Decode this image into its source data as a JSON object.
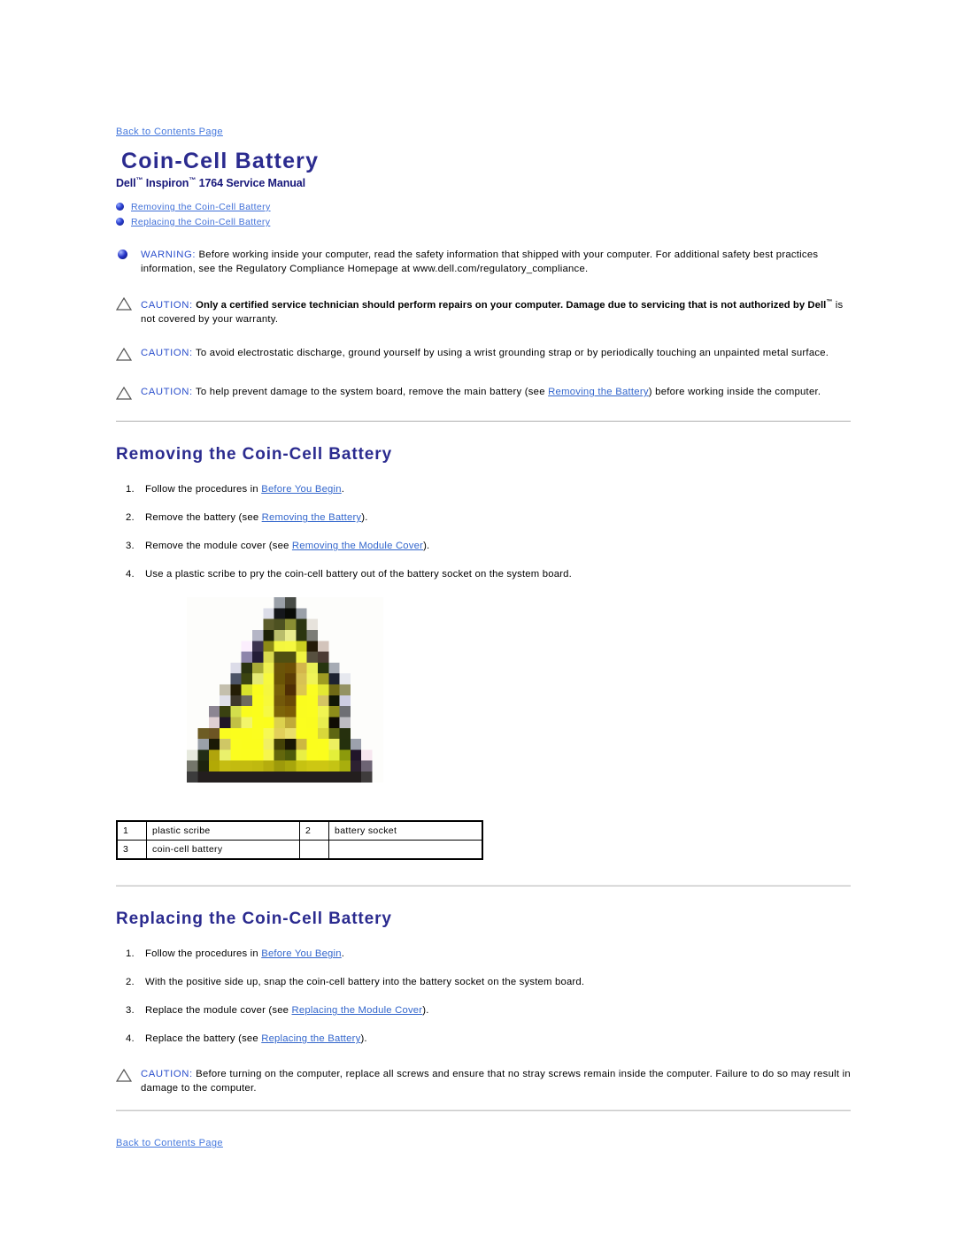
{
  "nav": {
    "back_to_contents": "Back to Contents Page"
  },
  "header": {
    "title": "Coin-Cell Battery",
    "subtitle_pre": "Dell",
    "subtitle_tm1": "™",
    "subtitle_mid": " Inspiron",
    "subtitle_tm2": "™",
    "subtitle_post": " 1764 Service Manual"
  },
  "toc": {
    "items": [
      {
        "label": "Removing the Coin-Cell Battery"
      },
      {
        "label": "Replacing the Coin-Cell Battery"
      }
    ]
  },
  "notices": [
    {
      "icon": "blue-sphere-icon",
      "keyword": "WARNING:",
      "text_a": " Before working inside your computer, read the safety information that shipped with your computer. For additional safety best practices information, see the Regulatory Compliance Homepage at www.dell.com/regulatory_compliance.",
      "bold": "",
      "text_b": "",
      "link": "",
      "text_c": ""
    },
    {
      "icon": "caution-triangle-icon",
      "keyword": "CAUTION:",
      "text_a": " ",
      "bold": "Only a certified service technician should perform repairs on your computer. Damage due to servicing that is not authorized by Dell",
      "bold_tm": "™",
      "text_b": " is not covered by your warranty.",
      "link": "",
      "text_c": ""
    },
    {
      "icon": "caution-triangle-icon",
      "keyword": "CAUTION:",
      "text_a": " To avoid electrostatic discharge, ground yourself by using a wrist grounding strap or by periodically touching an unpainted metal surface.",
      "bold": "",
      "text_b": "",
      "link": "",
      "text_c": ""
    },
    {
      "icon": "caution-triangle-icon",
      "keyword": "CAUTION:",
      "text_a": " To help prevent damage to the system board, remove the main battery (see ",
      "bold": "",
      "text_b": "",
      "link": "Removing the Battery",
      "text_c": ") before working inside the computer."
    }
  ],
  "removing": {
    "title": "Removing the Coin-Cell Battery",
    "steps": [
      {
        "num": "1.",
        "pre": "Follow the procedures in ",
        "link": "Before You Begin",
        "post": "."
      },
      {
        "num": "2.",
        "pre": "Remove the battery (see ",
        "link": "Removing the Battery",
        "post": ")."
      },
      {
        "num": "3.",
        "pre": "Remove the module cover (see ",
        "link": "Removing the Module Cover",
        "post": ")."
      },
      {
        "num": "4.",
        "pre": "Use a plastic scribe to pry the coin-cell battery out of the battery socket on the system board.",
        "link": "",
        "post": ""
      }
    ]
  },
  "figure": {
    "alt": "pixelated-yellow-warning-triangle-image"
  },
  "parts_table": {
    "rows": [
      {
        "n1": "1",
        "l1": "plastic scribe",
        "n2": "2",
        "l2": "battery socket"
      },
      {
        "n1": "3",
        "l1": "coin-cell battery",
        "n2": "",
        "l2": ""
      }
    ]
  },
  "replacing": {
    "title": "Replacing the Coin-Cell Battery",
    "steps": [
      {
        "num": "1.",
        "pre": "Follow the procedures in ",
        "link": "Before You Begin",
        "post": "."
      },
      {
        "num": "2.",
        "pre": "With the positive side up, snap the coin-cell battery into the battery socket on the system board.",
        "link": "",
        "post": ""
      },
      {
        "num": "3.",
        "pre": "Replace the module cover (see ",
        "link": "Replacing the Module Cover",
        "post": ")."
      },
      {
        "num": "4.",
        "pre": "Replace the battery (see ",
        "link": "Replacing the Battery",
        "post": ")."
      }
    ]
  },
  "final_notice": {
    "icon": "caution-triangle-icon",
    "keyword": "CAUTION:",
    "text_a": " Before turning on the computer, replace all screws and ensure that no stray screws remain inside the computer. Failure to do so may result in damage to the computer."
  },
  "colors": {
    "heading": "#2b2b8f",
    "link": "#3366cc",
    "keyword": "#2b4fcc",
    "rule": "#c9c9c9",
    "figure_yellow": "#ffff00"
  }
}
